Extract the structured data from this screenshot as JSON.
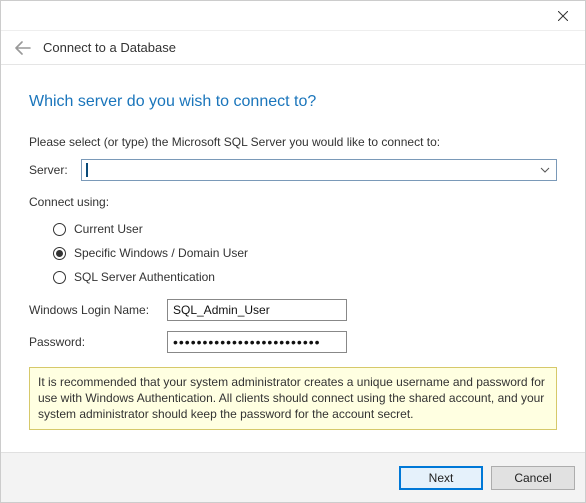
{
  "titlebar": {
    "close_icon": "close"
  },
  "header": {
    "back_icon": "back",
    "title": "Connect to a Database"
  },
  "main": {
    "heading": "Which server do you wish to connect to?",
    "instruction": "Please select (or type) the Microsoft SQL Server you would like to connect to:",
    "server_label": "Server:",
    "server_value": "",
    "connect_using_label": "Connect using:",
    "auth_options": {
      "current_user": "Current User",
      "specific_windows": "Specific Windows / Domain User",
      "sql_auth": "SQL Server Authentication",
      "selected": "specific_windows"
    },
    "login_label": "Windows Login Name:",
    "login_value": "SQL_Admin_User",
    "password_label": "Password:",
    "password_mask": "•••••••••••••••••••••••••",
    "info_text": "It is recommended that your system administrator creates a unique username and password for use with Windows Authentication. All clients should connect using the shared account, and your system administrator should keep the password for the account secret."
  },
  "footer": {
    "next_label": "Next",
    "cancel_label": "Cancel"
  }
}
